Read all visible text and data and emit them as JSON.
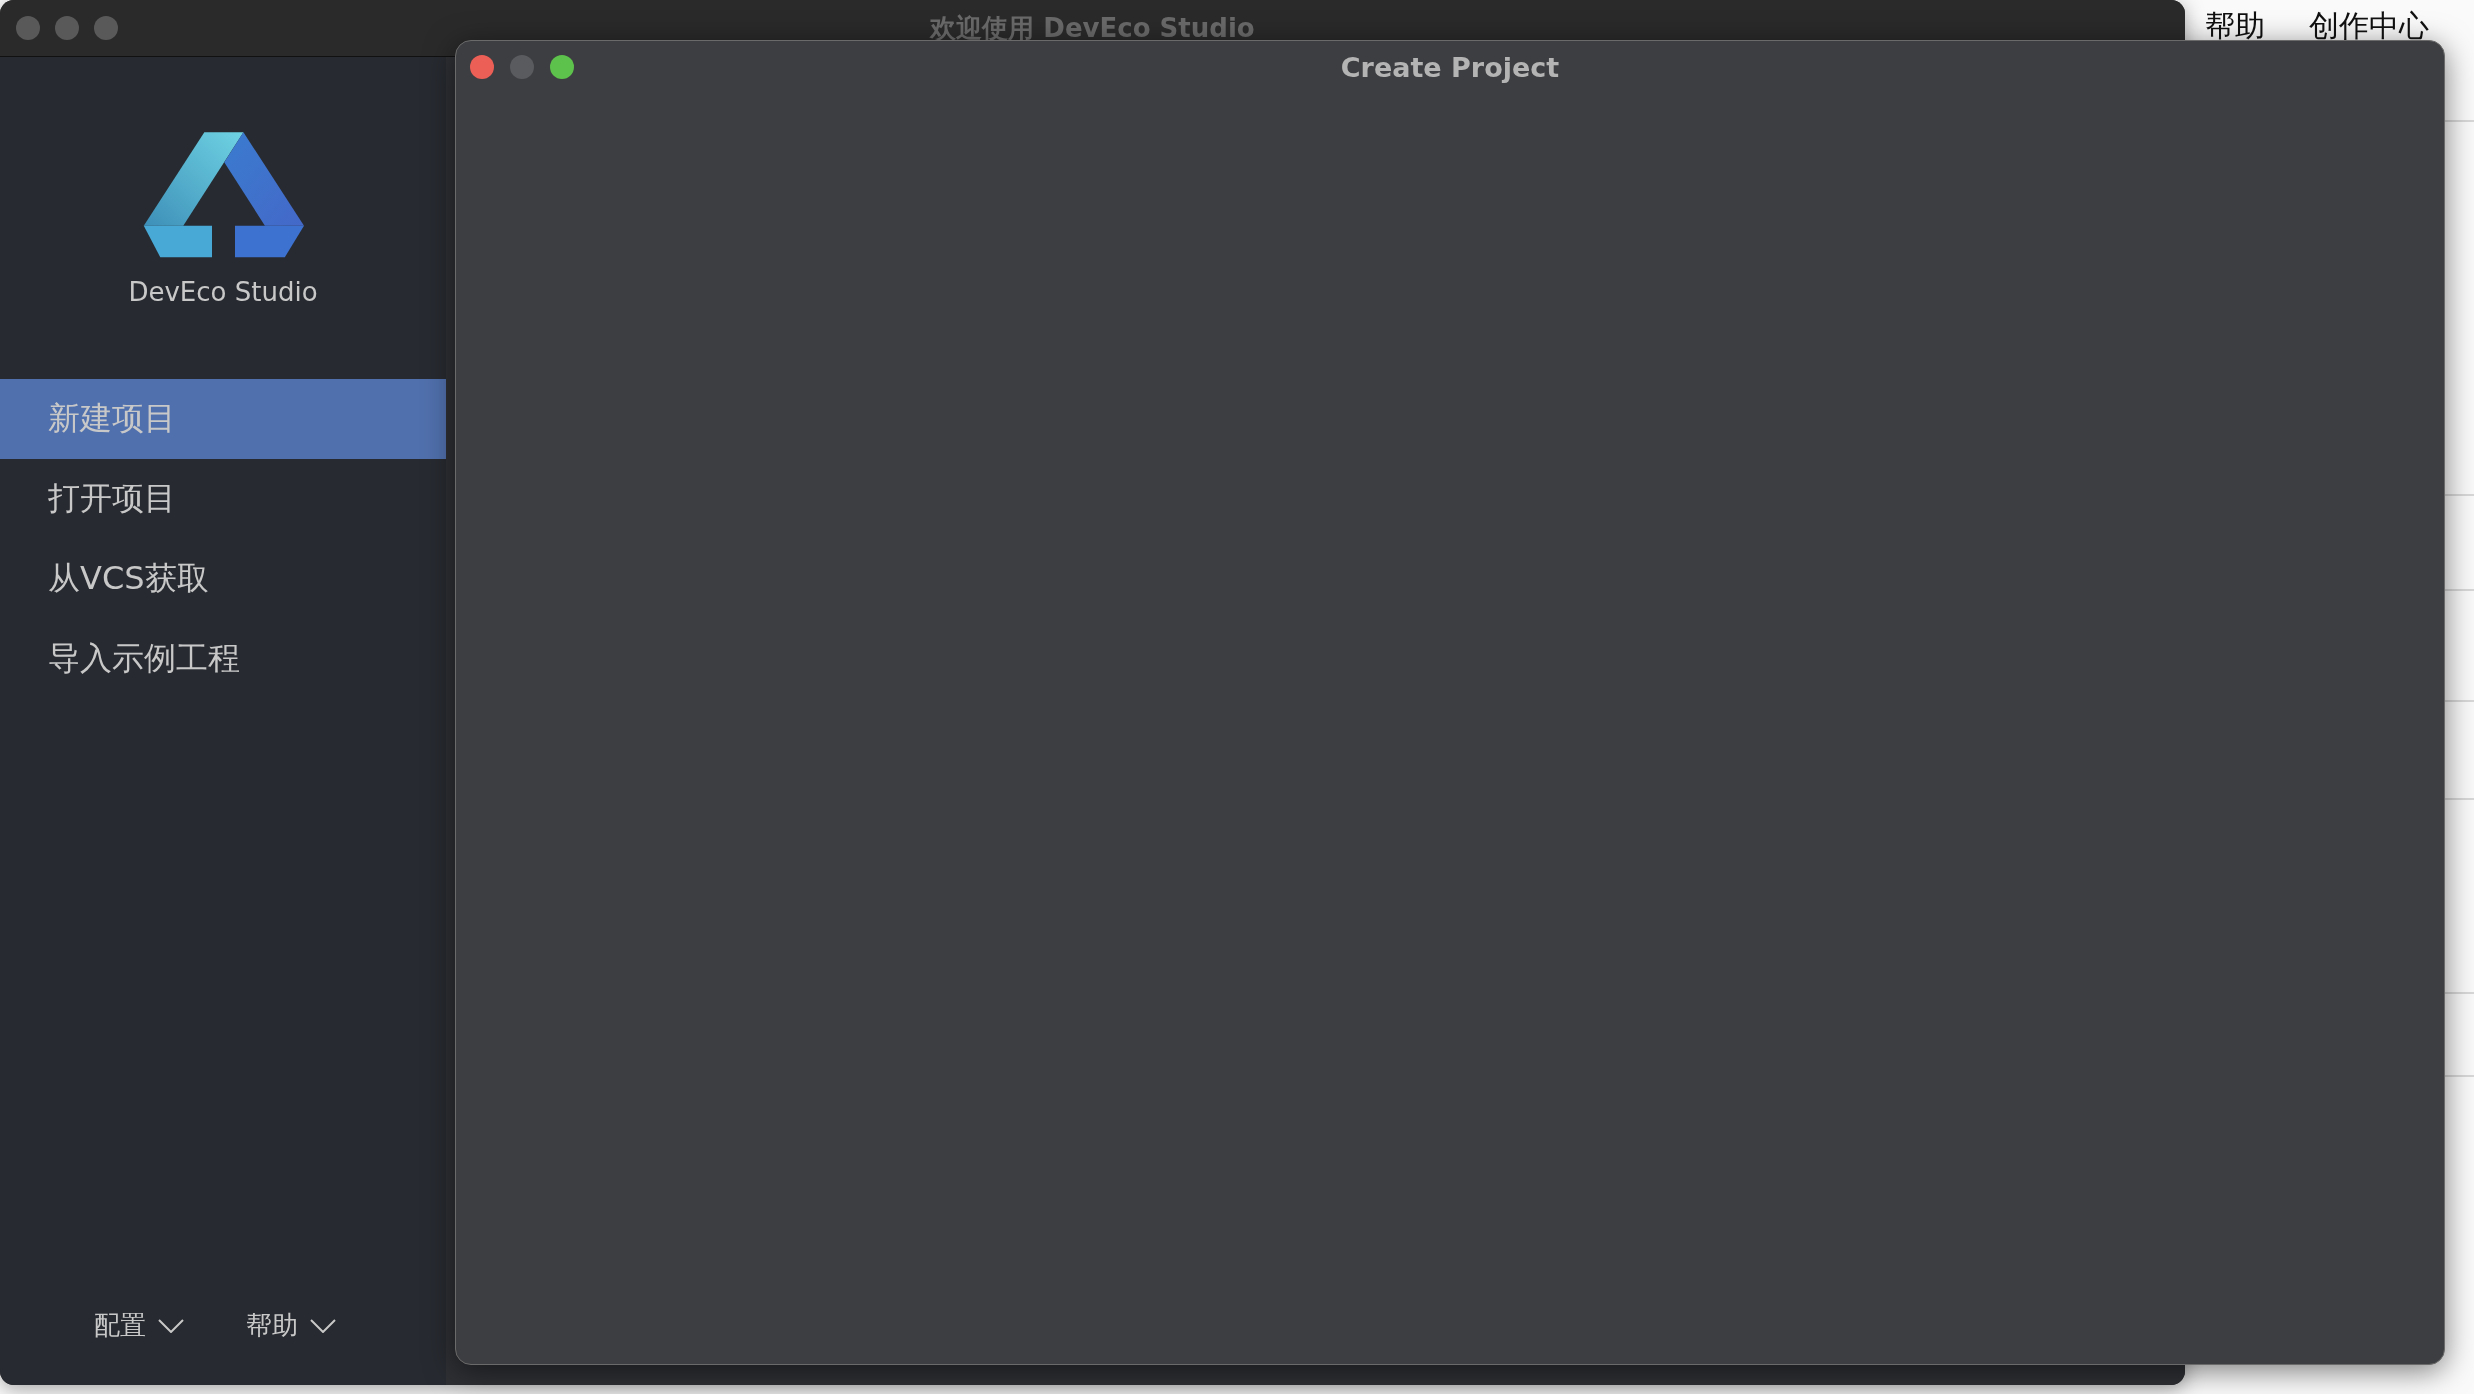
{
  "main_window": {
    "title": "欢迎使用 DevEco Studio"
  },
  "sidebar": {
    "app_name": "DevEco Studio",
    "items": [
      {
        "label": "新建项目",
        "selected": true
      },
      {
        "label": "打开项目",
        "selected": false
      },
      {
        "label": "从VCS获取",
        "selected": false
      },
      {
        "label": "导入示例工程",
        "selected": false
      }
    ],
    "footer_menus": [
      {
        "label": "配置"
      },
      {
        "label": "帮助"
      }
    ]
  },
  "dialog": {
    "title": "Create Project"
  },
  "background_page": {
    "menu_items": [
      "帮助",
      "创作中心"
    ]
  }
}
